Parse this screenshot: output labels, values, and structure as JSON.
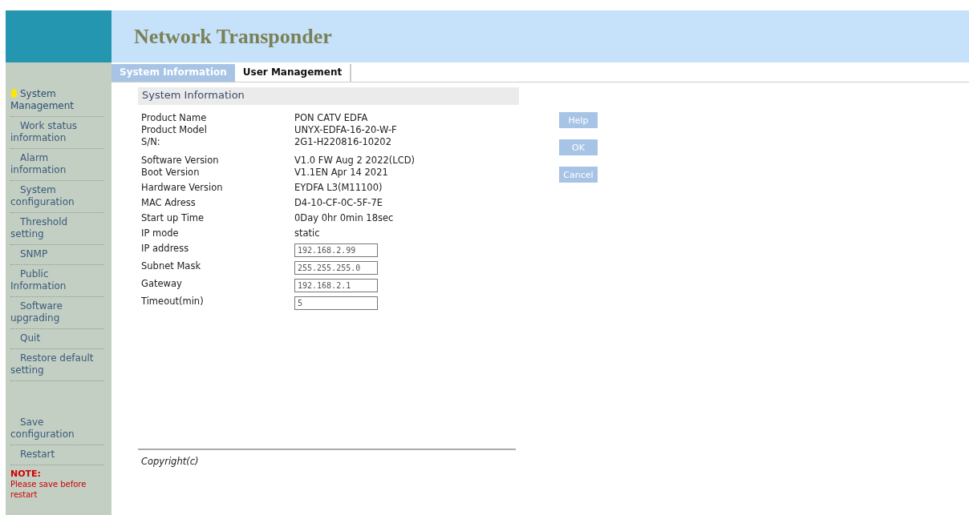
{
  "header": {
    "title": "Network Transponder"
  },
  "tabs": [
    {
      "label": "System Information",
      "selected": true
    },
    {
      "label": "User Management",
      "selected": false
    }
  ],
  "sidebar": {
    "items": [
      {
        "label": "System Management",
        "selected": true
      },
      {
        "label": "Work status information",
        "selected": false
      },
      {
        "label": "Alarm information",
        "selected": false
      },
      {
        "label": "System configuration",
        "selected": false
      },
      {
        "label": "Threshold setting",
        "selected": false
      },
      {
        "label": "SNMP",
        "selected": false
      },
      {
        "label": "Public Information",
        "selected": false
      },
      {
        "label": "Software upgrading",
        "selected": false
      },
      {
        "label": "Quit",
        "selected": false
      },
      {
        "label": "Restore default setting",
        "selected": false
      }
    ],
    "actions": [
      {
        "label": "Save configuration"
      },
      {
        "label": "Restart"
      }
    ],
    "note": {
      "title": "NOTE:",
      "text": "Please save before restart"
    }
  },
  "section": {
    "title": "System Information",
    "rows": [
      {
        "kind": "text",
        "label": "Product Name",
        "value": "PON CATV EDFA"
      },
      {
        "kind": "text",
        "label": "Product Model",
        "value": "UNYX-EDFA-16-20-W-F"
      },
      {
        "kind": "text",
        "label": "S/N:",
        "value": "2G1-H220816-10202"
      },
      {
        "kind": "text",
        "label": "Software Version",
        "value": "V1.0 FW Aug 2 2022(LCD)"
      },
      {
        "kind": "text",
        "label": "Boot Version",
        "value": "V1.1EN Apr 14 2021"
      },
      {
        "kind": "text",
        "label": "Hardware Version",
        "value": "EYDFA L3(M11100)"
      },
      {
        "kind": "text",
        "label": "MAC Adress",
        "value": "D4-10-CF-0C-5F-7E"
      },
      {
        "kind": "text",
        "label": "Start up Time",
        "value": "0Day 0hr 0min 18sec"
      },
      {
        "kind": "text",
        "label": "IP mode",
        "value": "static"
      },
      {
        "kind": "input",
        "label": "IP address",
        "value": "192.168.2.99"
      },
      {
        "kind": "input",
        "label": "Subnet Mask",
        "value": "255.255.255.0"
      },
      {
        "kind": "input",
        "label": "Gateway",
        "value": "192.168.2.1"
      },
      {
        "kind": "input",
        "label": "Timeout(min)",
        "value": "5"
      }
    ]
  },
  "buttons": [
    "Help",
    "OK",
    "Cancel"
  ],
  "footer": {
    "copyright": "Copyright(c)"
  }
}
